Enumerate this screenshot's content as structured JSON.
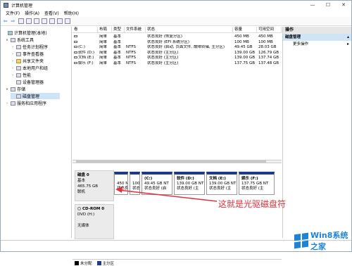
{
  "window": {
    "title": "计算机管理"
  },
  "titlebar_buttons": {
    "min": "—",
    "max": "☐",
    "close": "✕"
  },
  "menu": [
    "文件(F)",
    "操作(A)",
    "查看(V)",
    "帮助(H)"
  ],
  "tree": [
    {
      "label": "计算机管理(本地)",
      "expander": "",
      "icon": "computer-management-icon"
    },
    {
      "label": "系统工具",
      "expander": "∨",
      "icon": "tools-icon"
    },
    {
      "label": "任务计划程序",
      "expander": "›",
      "icon": "task-scheduler-icon"
    },
    {
      "label": "事件查看器",
      "expander": "›",
      "icon": "event-viewer-icon"
    },
    {
      "label": "共享文件夹",
      "expander": "›",
      "icon": "shared-folders-icon"
    },
    {
      "label": "本地用户和组",
      "expander": "›",
      "icon": "users-groups-icon"
    },
    {
      "label": "性能",
      "expander": "›",
      "icon": "performance-icon"
    },
    {
      "label": "设备管理器",
      "expander": "",
      "icon": "device-manager-icon"
    },
    {
      "label": "存储",
      "expander": "∨",
      "icon": "storage-icon"
    },
    {
      "label": "磁盘管理",
      "expander": "",
      "icon": "disk-management-icon"
    },
    {
      "label": "服务和应用程序",
      "expander": "›",
      "icon": "services-apps-icon"
    }
  ],
  "volume_table": {
    "headers": [
      "卷",
      "布局",
      "类型",
      "文件系统",
      "状态",
      "容量",
      "可用空间"
    ],
    "rows": [
      [
        "",
        "简单",
        "基本",
        "",
        "状态良好 (恢复分区)",
        "450 MB",
        "450 MB"
      ],
      [
        "",
        "简单",
        "基本",
        "",
        "状态良好 (EFI 系统分区)",
        "100 MB",
        "100 MB"
      ],
      [
        "(C:)",
        "简单",
        "基本",
        "NTFS",
        "状态良好 (启动, 页面文件, 故障转储, 主分区)",
        "49.45 GB",
        "28.03 GB"
      ],
      [
        "软件 (D:)",
        "简单",
        "基本",
        "NTFS",
        "状态良好 (主分区)",
        "139.00 GB",
        "126.79 GB"
      ],
      [
        "文档 (E:)",
        "简单",
        "基本",
        "NTFS",
        "状态良好 (主分区)",
        "139.00 GB",
        "137.74 GB"
      ],
      [
        "娱乐 (F:)",
        "简单",
        "基本",
        "NTFS",
        "状态良好 (主分区)",
        "137.75 GB",
        "137.48 GB"
      ]
    ]
  },
  "disk0": {
    "name": "磁盘 0",
    "type": "基本",
    "size": "465.75 GB",
    "status": "联机",
    "partitions": [
      {
        "title": "",
        "line1": "450 M",
        "line2": "状态良"
      },
      {
        "title": "",
        "line1": "100 I",
        "line2": "状态良"
      },
      {
        "title": "(C:)",
        "line1": "49.45 GB NT",
        "line2": "状态良好 (启"
      },
      {
        "title": "软件 (D:)",
        "line1": "139.00 GB NT",
        "line2": "状态良好 (主"
      },
      {
        "title": "文档 (E:)",
        "line1": "139.00 GB NT",
        "line2": "状态良好 (主"
      },
      {
        "title": "娱乐 (F:)",
        "line1": "137.75 GB NT",
        "line2": "状态良好 (主"
      }
    ]
  },
  "cdrom": {
    "name": "CD-ROM 0",
    "drive": "DVD (H:)",
    "media": "无媒体"
  },
  "legend": [
    {
      "label": "未分配",
      "color": "#000000"
    },
    {
      "label": "主分区",
      "color": "#1f3a8a"
    }
  ],
  "actions": {
    "header": "操作",
    "section": "磁盘管理",
    "more": "更多操作"
  },
  "annotation": "这就是光驱磁盘符",
  "watermark": "Win8系统之家",
  "colors": {
    "accent": "#1f3a8a",
    "annotation": "#e0323a",
    "selection": "#cfe3f7"
  }
}
